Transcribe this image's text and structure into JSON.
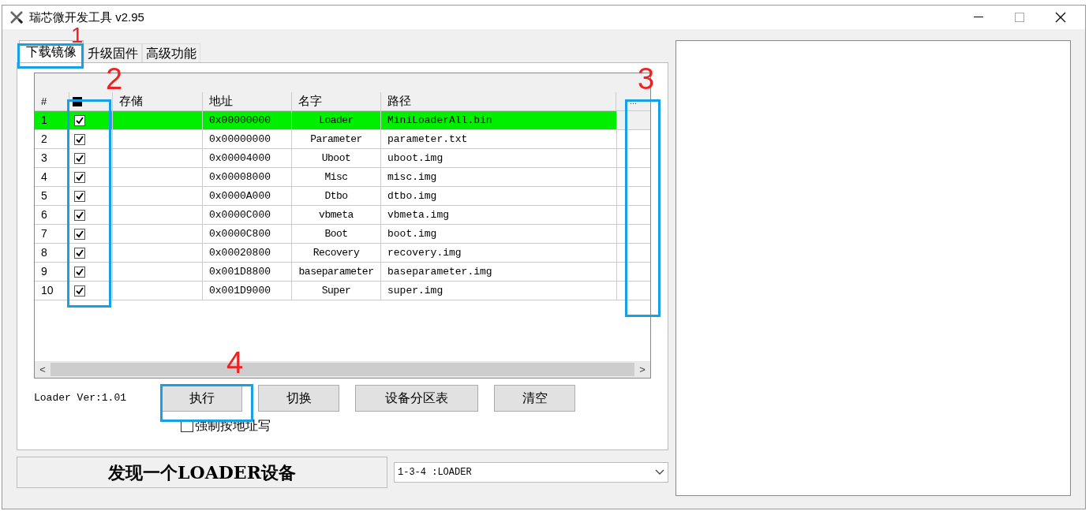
{
  "window": {
    "title": "瑞芯微开发工具 v2.95"
  },
  "tabs": [
    {
      "label": "下载镜像",
      "selected": true
    },
    {
      "label": "升级固件",
      "selected": false
    },
    {
      "label": "高级功能",
      "selected": false
    }
  ],
  "table": {
    "columns": [
      "#",
      "存储",
      "地址",
      "名字",
      "路径",
      "..."
    ],
    "all_checked": true,
    "rows": [
      {
        "num": "1",
        "checked": true,
        "address": "0x00000000",
        "name": "Loader",
        "path": "MiniLoaderAll.bin",
        "selected": true
      },
      {
        "num": "2",
        "checked": true,
        "address": "0x00000000",
        "name": "Parameter",
        "path": "parameter.txt",
        "selected": false
      },
      {
        "num": "3",
        "checked": true,
        "address": "0x00004000",
        "name": "Uboot",
        "path": "uboot.img",
        "selected": false
      },
      {
        "num": "4",
        "checked": true,
        "address": "0x00008000",
        "name": "Misc",
        "path": "misc.img",
        "selected": false
      },
      {
        "num": "5",
        "checked": true,
        "address": "0x0000A000",
        "name": "Dtbo",
        "path": "dtbo.img",
        "selected": false
      },
      {
        "num": "6",
        "checked": true,
        "address": "0x0000C000",
        "name": "vbmeta",
        "path": "vbmeta.img",
        "selected": false
      },
      {
        "num": "7",
        "checked": true,
        "address": "0x0000C800",
        "name": "Boot",
        "path": "boot.img",
        "selected": false
      },
      {
        "num": "8",
        "checked": true,
        "address": "0x00020800",
        "name": "Recovery",
        "path": "recovery.img",
        "selected": false
      },
      {
        "num": "9",
        "checked": true,
        "address": "0x001D8800",
        "name": "baseparameter",
        "path": "baseparameter.img",
        "selected": false
      },
      {
        "num": "10",
        "checked": true,
        "address": "0x001D9000",
        "name": "Super",
        "path": "super.img",
        "selected": false
      }
    ]
  },
  "scroll_left": "<",
  "scroll_right": ">",
  "loader_version": "Loader Ver:1.01",
  "buttons": [
    "执行",
    "切换",
    "设备分区表",
    "清空"
  ],
  "force_address": {
    "label": "强制按地址写",
    "checked": false
  },
  "status": "发现一个LOADER设备",
  "device": {
    "value": "1-3-4 :LOADER"
  },
  "annotations": [
    "1",
    "2",
    "3",
    "4"
  ]
}
